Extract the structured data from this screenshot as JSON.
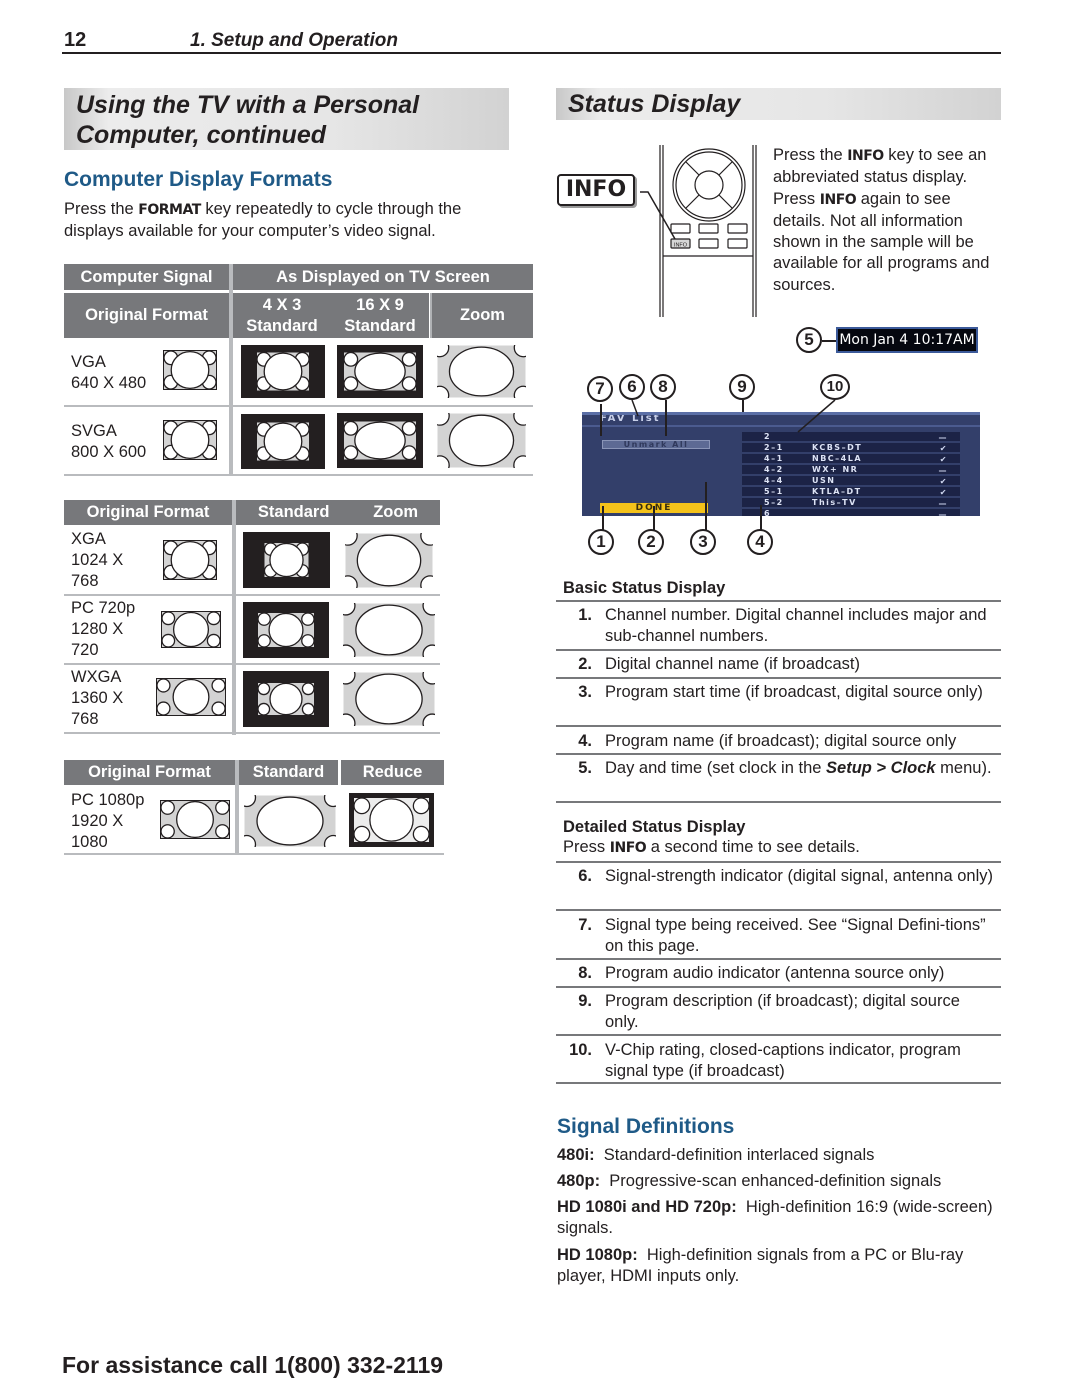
{
  "header": {
    "page_number": "12",
    "chapter": "1.  Setup and Operation"
  },
  "left": {
    "title_line1": "Using the TV with a Personal",
    "title_line2": "Computer, continued",
    "section_heading": "Computer Display Formats",
    "intro_pre": "Press the ",
    "intro_key": "FORMAT",
    "intro_post": " key repeatedly to cycle through the displays available for your computer’s video signal.",
    "table1": {
      "header_left": "Computer Signal",
      "header_right": "As Displayed on TV Screen",
      "sub_original": "Original Format",
      "sub_col1_line1": "4 X 3",
      "sub_col1_line2": "Standard",
      "sub_col2_line1": "16 X 9",
      "sub_col2_line2": "Standard",
      "sub_col3": "Zoom",
      "rows": [
        {
          "name": "VGA",
          "resolution": "640 X 480"
        },
        {
          "name": "SVGA",
          "resolution": "800 X 600"
        }
      ]
    },
    "table2": {
      "col_original": "Original Format",
      "col_standard": "Standard",
      "col_zoom": "Zoom",
      "rows": [
        {
          "line1": "XGA",
          "line2": "1024 X",
          "line3": "768"
        },
        {
          "line1": "PC 720p",
          "line2": "1280 X",
          "line3": "720"
        },
        {
          "line1": "WXGA",
          "line2": "1360 X",
          "line3": "768"
        }
      ]
    },
    "table3": {
      "col_original": "Original Format",
      "col_standard": "Standard",
      "col_reduce": "Reduce",
      "rows": [
        {
          "line1": "PC 1080p",
          "line2": "1920 X",
          "line3": "1080"
        }
      ]
    }
  },
  "right": {
    "title": "Status Display",
    "info_key_label": "INFO",
    "remote_info_label": "INFO",
    "intro_p1_pre": "Press the ",
    "intro_p1_key": "INFO",
    "intro_p1_post": " key to see an abbreviated status display.",
    "intro_p2_pre": "Press ",
    "intro_p2_key": "INFO",
    "intro_p2_post": " again to see details.  Not all information shown in the sample will be available for all programs and sources.",
    "clock_text": "Mon Jan 4 10:17AM",
    "fav_list": {
      "title": "FAV List",
      "unmark_button": "Unmark All",
      "done_button": "DONE",
      "channels": [
        {
          "num": "2",
          "name": "",
          "mark": "—"
        },
        {
          "num": "2–1",
          "name": "KCBS–DT",
          "mark": "✔"
        },
        {
          "num": "4–1",
          "name": "NBC–4LA",
          "mark": "✔"
        },
        {
          "num": "4–2",
          "name": "WX+ NR",
          "mark": "—"
        },
        {
          "num": "4–4",
          "name": "USN",
          "mark": "✔"
        },
        {
          "num": "5–1",
          "name": "KTLA–DT",
          "mark": "✔"
        },
        {
          "num": "5–2",
          "name": "This–TV",
          "mark": "—"
        },
        {
          "num": "6",
          "name": "",
          "mark": "—"
        }
      ]
    },
    "callouts": [
      "1",
      "2",
      "3",
      "4",
      "5",
      "6",
      "7",
      "8",
      "9",
      "10"
    ],
    "basic": {
      "heading": "Basic Status Display",
      "items": [
        {
          "n": "1.",
          "text": "Channel number.  Digital channel includes major and sub-channel numbers."
        },
        {
          "n": "2.",
          "text": "Digital channel name (if broadcast)"
        },
        {
          "n": "3.",
          "text": "Program start time (if broadcast, digital source only)"
        },
        {
          "n": "4.",
          "text": "Program name (if broadcast); digital source only"
        },
        {
          "n": "5.",
          "text_pre": "Day and time (set clock in the ",
          "text_em": "Setup > Clock",
          "text_post": " menu)."
        }
      ]
    },
    "detailed": {
      "heading": "Detailed Status Display",
      "sub_pre": "Press ",
      "sub_key": "INFO",
      "sub_post": " a second time to see details.",
      "items": [
        {
          "n": "6.",
          "text": "Signal-strength indicator (digital signal, antenna only)"
        },
        {
          "n": "7.",
          "text": "Signal type being received.  See “Signal Defini-tions” on this page."
        },
        {
          "n": "8.",
          "text": "Program audio indicator (antenna source only)"
        },
        {
          "n": "9.",
          "text": "Program description (if broadcast); digital source only."
        },
        {
          "n": "10.",
          "text": "V-Chip rating, closed-captions indicator, program signal type (if broadcast)"
        }
      ]
    },
    "signal_definitions": {
      "heading": "Signal Definitions",
      "items": [
        {
          "term": "480i:",
          "desc": "Standard-definition interlaced signals"
        },
        {
          "term": "480p:",
          "desc": "Progressive-scan enhanced-definition signals"
        },
        {
          "term": "HD 1080i and HD 720p:",
          "desc": "High-definition 16:9 (wide-screen) signals."
        },
        {
          "term": "HD 1080p:",
          "desc": "High-definition signals from a PC or Blu-ray player, HDMI inputs only."
        }
      ]
    }
  },
  "footer": {
    "assistance": "For assistance call 1(800) 332-2119"
  },
  "colors": {
    "section_heading": "#1f5a87",
    "table_header": "#77787b",
    "fav_panel": "#333f6a",
    "done_button": "#f4c21a"
  }
}
